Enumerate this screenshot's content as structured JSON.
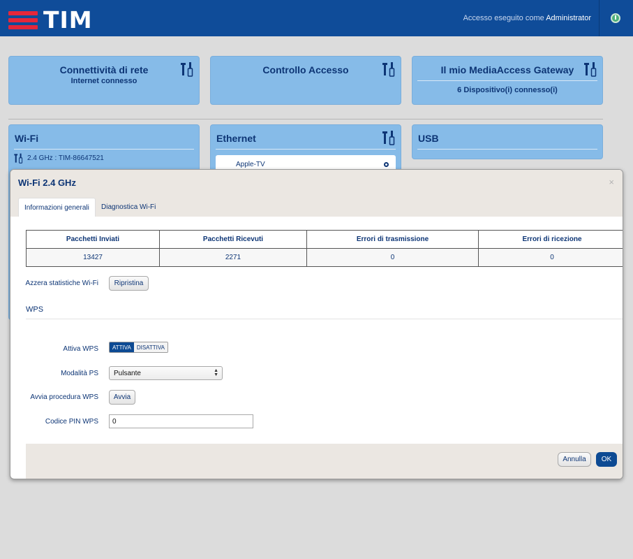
{
  "header": {
    "logo_text": "TIM",
    "login_prefix": "Accesso eseguito come",
    "login_user": "Administrator",
    "brand_color": "#0f4c99",
    "logo_accent": "#e5273a"
  },
  "cards": {
    "connectivity": {
      "title": "Connettività di rete",
      "subtitle": "Internet connesso"
    },
    "access": {
      "title": "Controllo Accesso"
    },
    "gateway": {
      "title": "Il mio MediaAccess Gateway",
      "subtitle": "6 Dispositivo(i) connesso(i)"
    },
    "wifi": {
      "title": "Wi-Fi",
      "network": "2.4 GHz : TIM-86647521"
    },
    "ethernet": {
      "title": "Ethernet",
      "device": "Apple-TV"
    },
    "usb": {
      "title": "USB"
    }
  },
  "modal": {
    "title": "Wi-Fi 2.4 GHz",
    "close": "×",
    "tabs": [
      "Informazioni generali",
      "Diagnostica Wi-Fi"
    ],
    "stats_headers": [
      "Pacchetti Inviati",
      "Pacchetti Ricevuti",
      "Errori di trasmissione",
      "Errori di ricezione"
    ],
    "stats_values": [
      "13427",
      "2271",
      "0",
      "0"
    ],
    "reset_label": "Azzera statistiche Wi-Fi",
    "reset_button": "Ripristina",
    "wps_heading": "WPS",
    "wps_enable_label": "Attiva WPS",
    "wps_on": "ATTIVA",
    "wps_off": "DISATTIVA",
    "ps_mode_label": "Modalità PS",
    "ps_mode_value": "Pulsante",
    "wps_start_label": "Avvia procedura WPS",
    "wps_start_button": "Avvia",
    "wps_pin_label": "Codice PIN WPS",
    "wps_pin_value": "0",
    "cancel_button": "Annulla",
    "ok_button": "OK"
  }
}
